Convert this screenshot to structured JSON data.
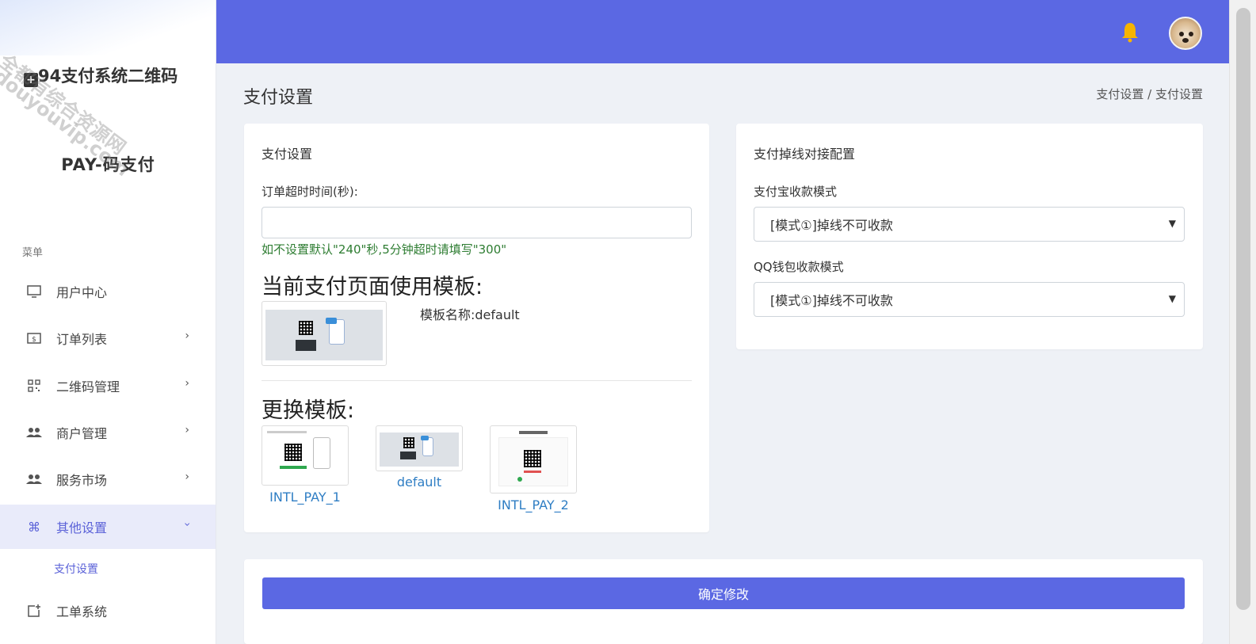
{
  "sidebar": {
    "logo_line1": "94支付系统二维码",
    "logo_line2": "PAY-码支付",
    "watermark_text": "全都有综合资源网",
    "watermark_url": "douyouvip.com",
    "menu_caption": "菜单",
    "items": [
      {
        "label": "用户中心",
        "icon": "monitor-icon",
        "has_chevron": false
      },
      {
        "label": "订单列表",
        "icon": "dollar-card-icon",
        "has_chevron": true
      },
      {
        "label": "二维码管理",
        "icon": "qrcode-icon",
        "has_chevron": true
      },
      {
        "label": "商户管理",
        "icon": "users-icon",
        "has_chevron": true
      },
      {
        "label": "服务市场",
        "icon": "users-icon",
        "has_chevron": true
      },
      {
        "label": "其他设置",
        "icon": "command-icon",
        "has_chevron": true,
        "active": true
      },
      {
        "label": "工单系统",
        "icon": "new-ticket-icon",
        "has_chevron": false
      }
    ],
    "sub_item": "支付设置"
  },
  "header": {
    "bell_icon": "bell-icon",
    "avatar_icon": "dog-avatar"
  },
  "page": {
    "title": "支付设置",
    "breadcrumb": "支付设置 / 支付设置"
  },
  "left_card": {
    "title": "支付设置",
    "timeout_label": "订单超时时间(秒):",
    "timeout_value": "",
    "hint": "如不设置默认\"240\"秒,5分钟超时请填写\"300\"",
    "current_template_heading": "当前支付页面使用模板:",
    "template_name_label": "模板名称:default",
    "change_template_heading": "更换模板:",
    "templates": [
      "INTL_PAY_1",
      "default",
      "INTL_PAY_2"
    ]
  },
  "right_card": {
    "title": "支付掉线对接配置",
    "alipay_label": "支付宝收款模式",
    "alipay_value": "[模式①]掉线不可收款",
    "qq_label": "QQ钱包收款模式",
    "qq_value": "[模式①]掉线不可收款"
  },
  "footer": {
    "submit_label": "确定修改"
  },
  "colors": {
    "primary": "#5b68e3",
    "active_bg": "#e9ebfa",
    "hint_green": "#2e7d32",
    "link_blue": "#2f7ec4"
  }
}
